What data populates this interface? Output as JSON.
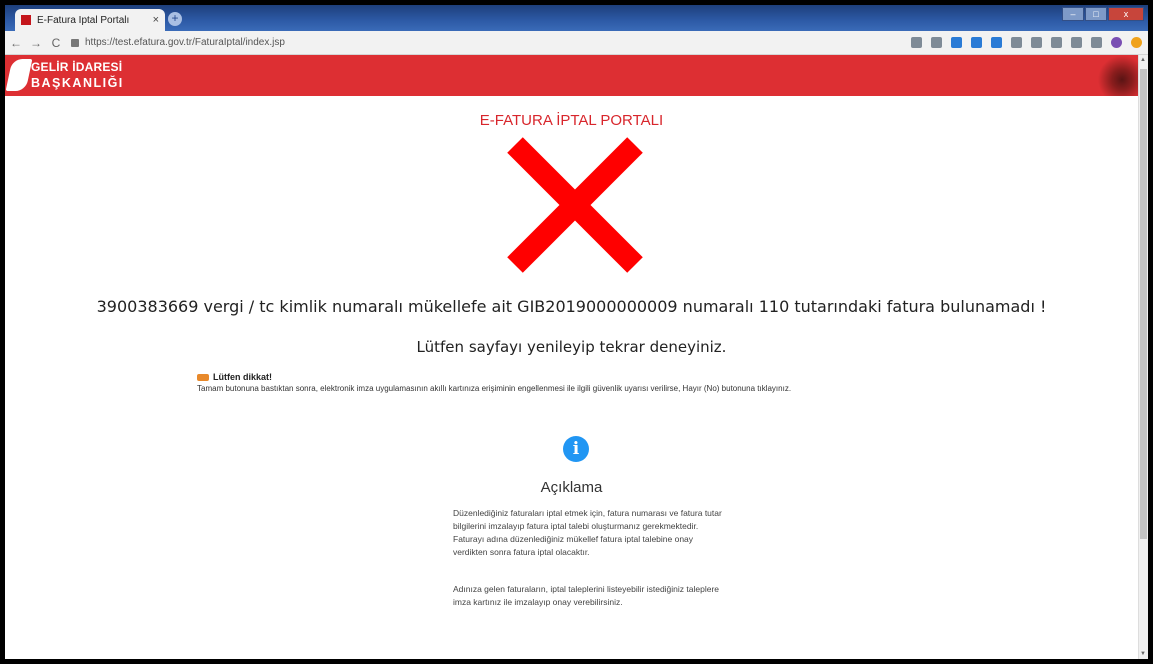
{
  "browser": {
    "tab_title": "E-Fatura İptal Portalı",
    "tab_close": "×",
    "new_tab": "+",
    "url": "https://test.efatura.gov.tr/FaturaIptal/index.jsp",
    "nav": {
      "back": "←",
      "forward": "→",
      "reload": "C"
    },
    "window": {
      "minimize": "–",
      "maximize": "□",
      "close": "x"
    }
  },
  "header": {
    "logo_line1": "GELİR İDARESİ",
    "logo_line2": "BAŞKANLIĞI",
    "color": "#dd2f33"
  },
  "main": {
    "portal_title": "E-FATURA İPTAL PORTALI",
    "error_icon": "x-icon",
    "error_color": "#ff0000",
    "message": "3900383669 vergi / tc kimlik numaralı mükellefe ait GIB2019000000009 numaralı 110 tutarındaki fatura bulunamadı !",
    "retry": "Lütfen sayfayı yenileyip tekrar deneyiniz.",
    "warning": {
      "title": "Lütfen dikkat!",
      "text": "Tamam butonuna bastıktan sonra, elektronik imza uygulamasının akıllı kartınıza erişiminin engellenmesi ile ilgili güvenlik uyarısı verilirse, Hayır (No) butonuna tıklayınız."
    },
    "info": {
      "icon_glyph": "i",
      "title": "Açıklama",
      "paragraph1": "Düzenlediğiniz faturaları iptal etmek için, fatura numarası ve fatura tutar bilgilerini imzalayıp fatura iptal talebi oluşturmanız gerekmektedir. Faturayı adına düzenlediğiniz mükellef fatura iptal talebine onay verdikten sonra fatura iptal olacaktır.",
      "paragraph2": "Adınıza gelen faturaların, iptal taleplerini listeyebilir istediğiniz taleplere imza kartınız ile imzalayıp onay verebilirsiniz."
    }
  }
}
